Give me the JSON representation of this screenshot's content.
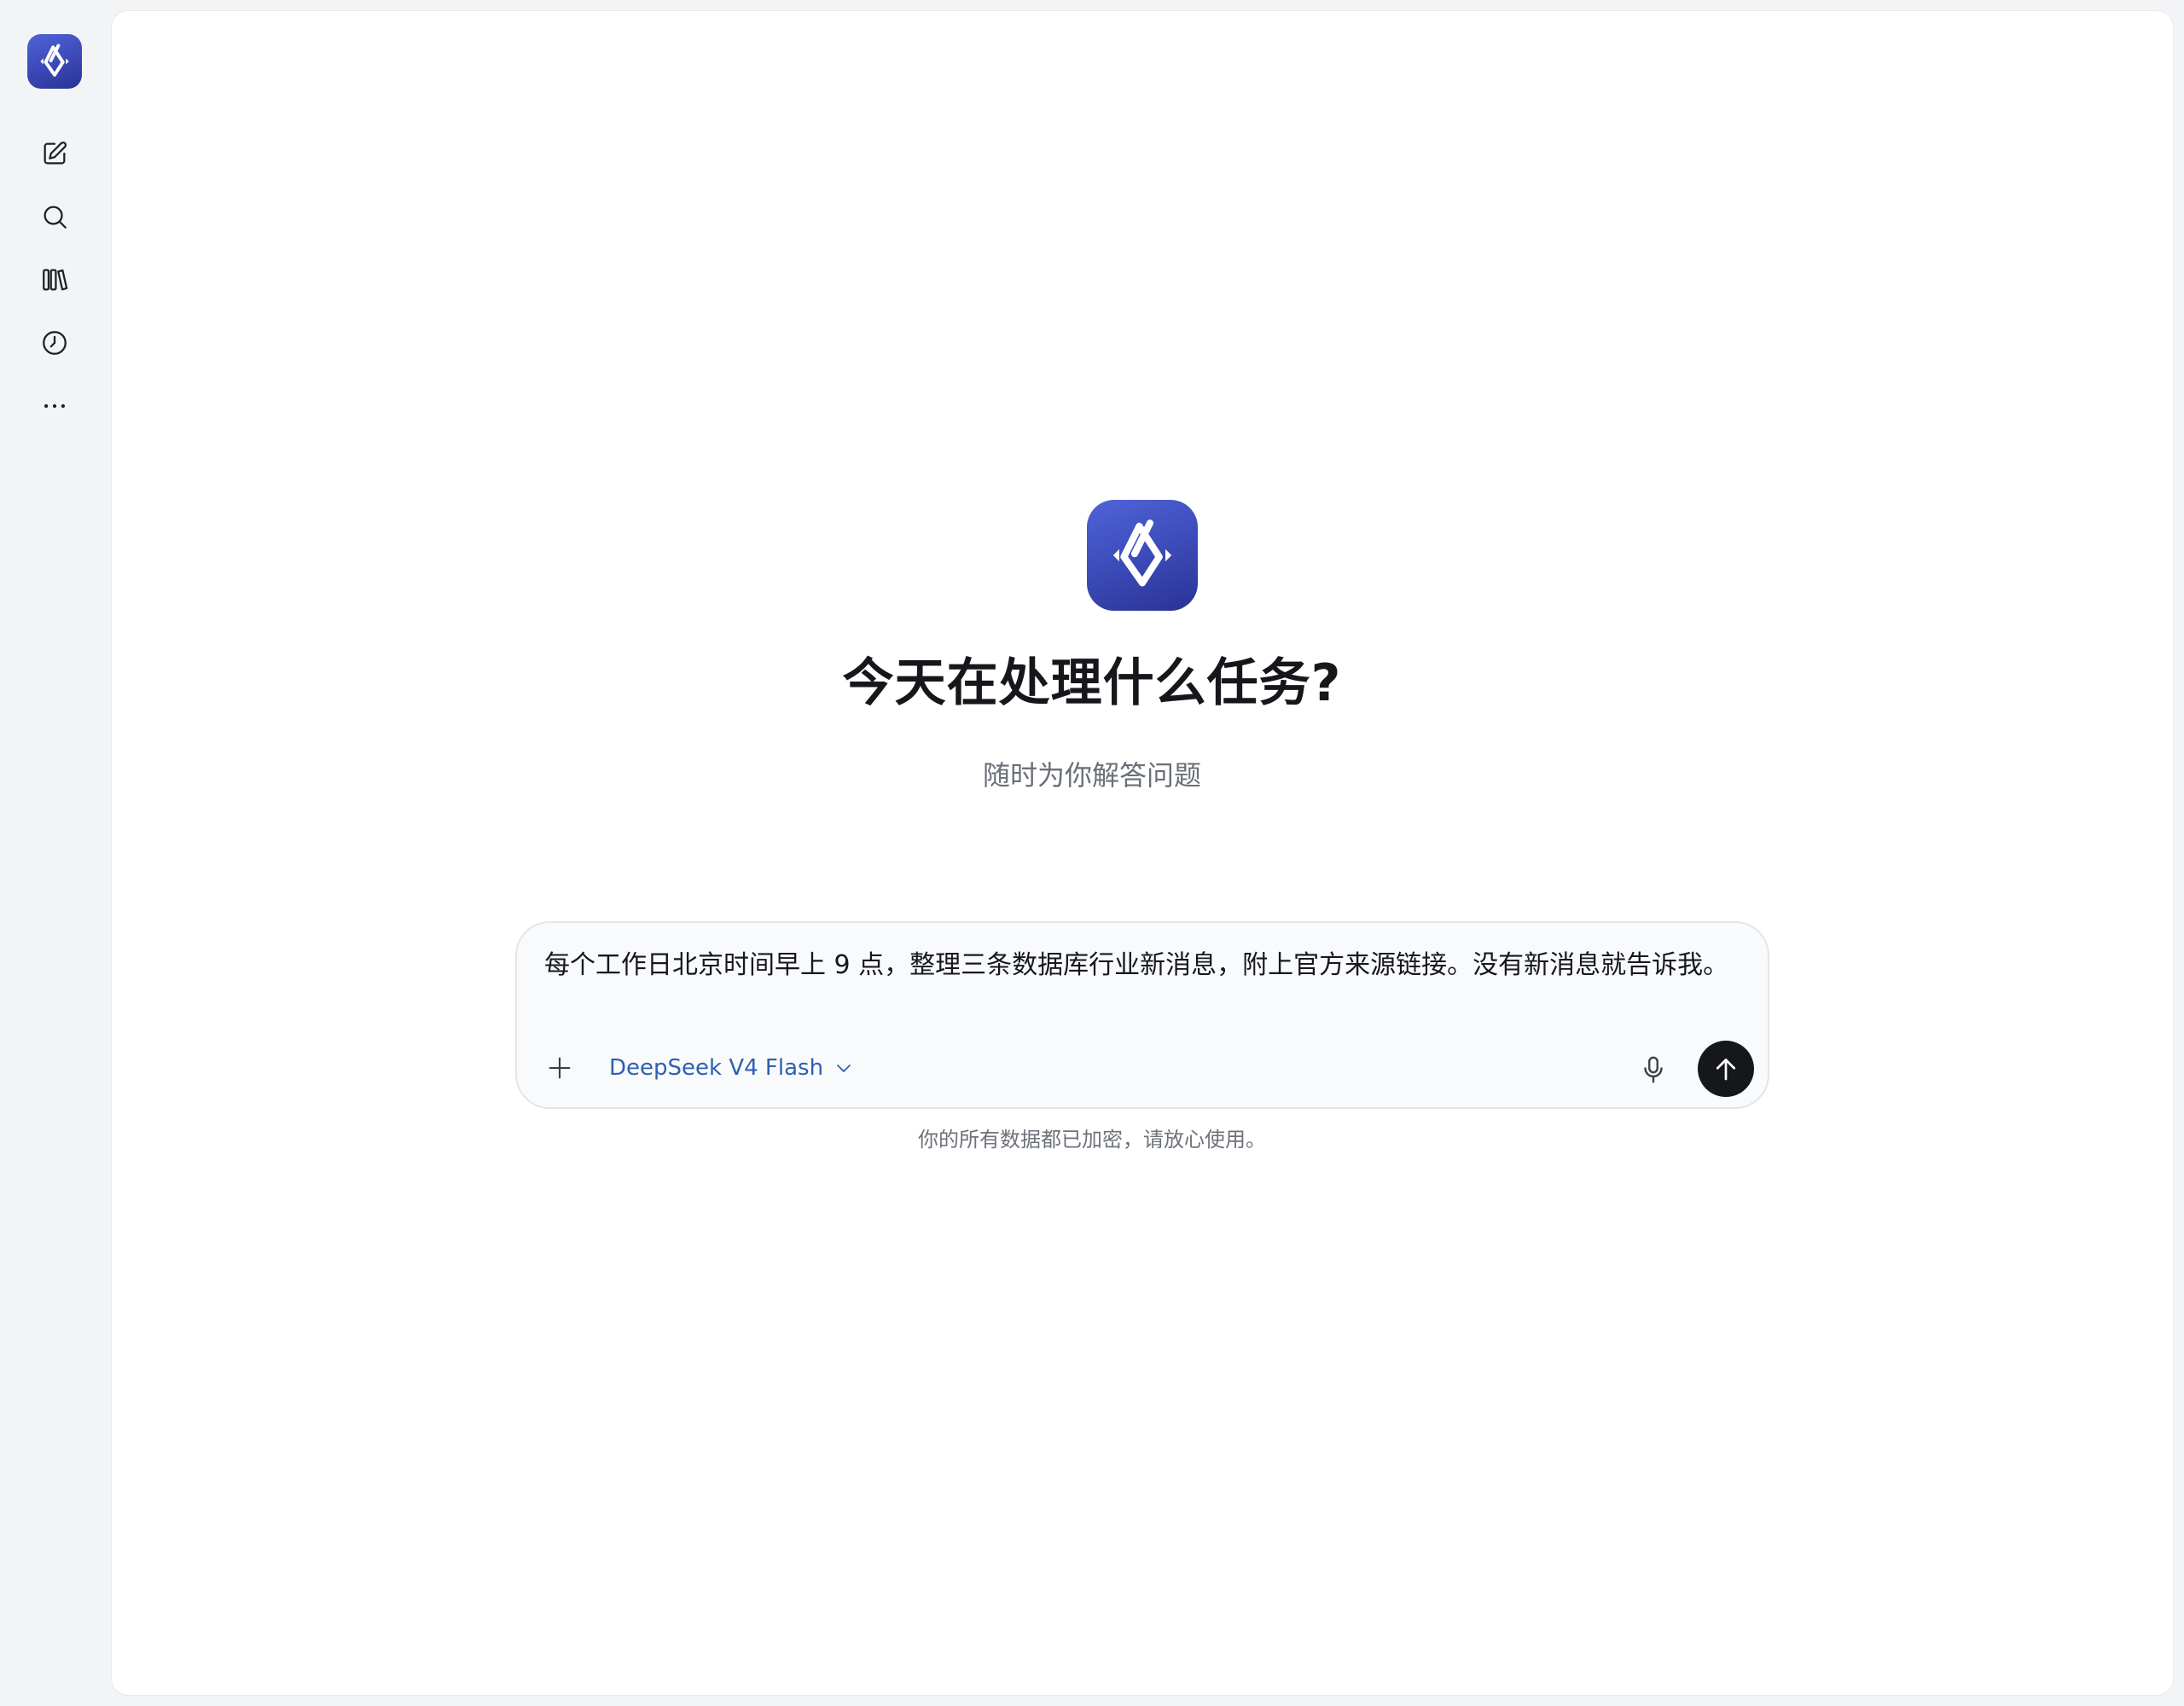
{
  "sidebar": {
    "logo_icon": "app-logo-icon",
    "items": [
      {
        "name": "new-chat",
        "icon": "edit-icon"
      },
      {
        "name": "search",
        "icon": "search-icon"
      },
      {
        "name": "library",
        "icon": "library-icon"
      },
      {
        "name": "history",
        "icon": "clock-icon"
      },
      {
        "name": "more",
        "icon": "more-icon"
      }
    ]
  },
  "hero": {
    "title": "今天在处理什么任务?",
    "subtitle": "随时为你解答问题"
  },
  "composer": {
    "input_value": "每个工作日北京时间早上 9 点，整理三条数据库行业新消息，附上官方来源链接。没有新消息就告诉我。",
    "model_label": "DeepSeek V4 Flash"
  },
  "disclaimer": "你的所有数据都已加密，请放心使用。",
  "colors": {
    "brand_gradient_top": "#4f62d6",
    "brand_gradient_bottom": "#2a3393",
    "model_link": "#2f5fb3",
    "send_button": "#15171b"
  }
}
